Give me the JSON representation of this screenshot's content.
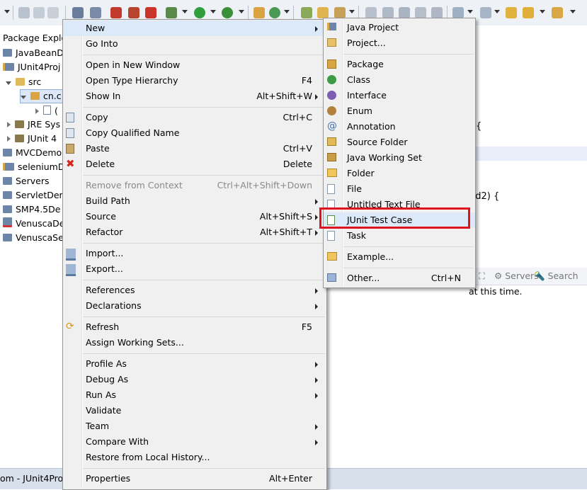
{
  "explorer": {
    "title": "Package Explo",
    "rows": [
      {
        "label": "JavaBeanD"
      },
      {
        "label": "JUnit4Proj"
      },
      {
        "label": "src"
      },
      {
        "label": "cn.c"
      },
      {
        "label": "("
      },
      {
        "label": "JRE Sys"
      },
      {
        "label": "JUnit 4"
      },
      {
        "label": "MVCDemo"
      },
      {
        "label": "seleniumD"
      },
      {
        "label": "Servers"
      },
      {
        "label": "ServletDer"
      },
      {
        "label": "SMP4.5De"
      },
      {
        "label": "VenuscaDe"
      },
      {
        "label": "VenuscaSe"
      }
    ]
  },
  "editor": {
    "line1": "{",
    "line2": "nd2) {",
    "bottom_tabs": {
      "servers": "Servers",
      "search": "Search"
    },
    "message": "at this time."
  },
  "status": {
    "text": "om - JUnit4Proj"
  },
  "menu": {
    "items": [
      {
        "label": "New",
        "shortcut": "",
        "submenu": true
      },
      {
        "label": "Go Into",
        "shortcut": ""
      },
      {
        "label": "Open in New Window",
        "shortcut": ""
      },
      {
        "label": "Open Type Hierarchy",
        "shortcut": "F4"
      },
      {
        "label": "Show In",
        "shortcut": "Alt+Shift+W",
        "submenu": true
      },
      {
        "label": "Copy",
        "shortcut": "Ctrl+C"
      },
      {
        "label": "Copy Qualified Name",
        "shortcut": ""
      },
      {
        "label": "Paste",
        "shortcut": "Ctrl+V"
      },
      {
        "label": "Delete",
        "shortcut": "Delete"
      },
      {
        "label": "Remove from Context",
        "shortcut": "Ctrl+Alt+Shift+Down"
      },
      {
        "label": "Build Path",
        "shortcut": "",
        "submenu": true
      },
      {
        "label": "Source",
        "shortcut": "Alt+Shift+S",
        "submenu": true
      },
      {
        "label": "Refactor",
        "shortcut": "Alt+Shift+T",
        "submenu": true
      },
      {
        "label": "Import...",
        "shortcut": ""
      },
      {
        "label": "Export...",
        "shortcut": ""
      },
      {
        "label": "References",
        "shortcut": "",
        "submenu": true
      },
      {
        "label": "Declarations",
        "shortcut": "",
        "submenu": true
      },
      {
        "label": "Refresh",
        "shortcut": "F5"
      },
      {
        "label": "Assign Working Sets...",
        "shortcut": ""
      },
      {
        "label": "Profile As",
        "shortcut": "",
        "submenu": true
      },
      {
        "label": "Debug As",
        "shortcut": "",
        "submenu": true
      },
      {
        "label": "Run As",
        "shortcut": "",
        "submenu": true
      },
      {
        "label": "Validate",
        "shortcut": ""
      },
      {
        "label": "Team",
        "shortcut": "",
        "submenu": true
      },
      {
        "label": "Compare With",
        "shortcut": "",
        "submenu": true
      },
      {
        "label": "Restore from Local History...",
        "shortcut": ""
      },
      {
        "label": "Properties",
        "shortcut": "Alt+Enter"
      }
    ]
  },
  "submenu": {
    "items": [
      {
        "label": "Java Project"
      },
      {
        "label": "Project..."
      },
      {
        "label": "Package"
      },
      {
        "label": "Class"
      },
      {
        "label": "Interface"
      },
      {
        "label": "Enum"
      },
      {
        "label": "Annotation"
      },
      {
        "label": "Source Folder"
      },
      {
        "label": "Java Working Set"
      },
      {
        "label": "Folder"
      },
      {
        "label": "File"
      },
      {
        "label": "Untitled Text File"
      },
      {
        "label": "JUnit Test Case"
      },
      {
        "label": "Task"
      },
      {
        "label": "Example..."
      },
      {
        "label": "Other...",
        "shortcut": "Ctrl+N"
      }
    ]
  },
  "colors": {
    "highlight_box": "#e0121e",
    "menu_bg": "#f0f0f0"
  }
}
